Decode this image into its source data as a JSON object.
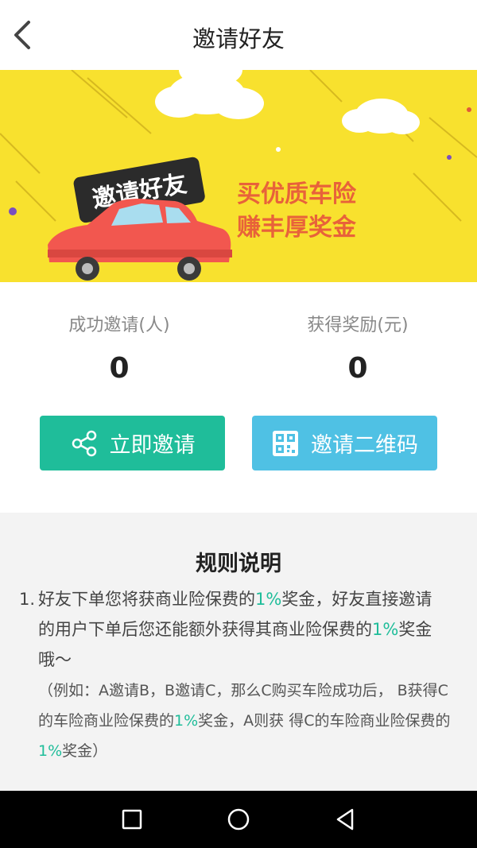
{
  "nav": {
    "title": "邀请好友"
  },
  "banner": {
    "badge": "邀请好友",
    "slogan_line1": "买优质车险",
    "slogan_line2": "赚丰厚奖金",
    "colors": {
      "background": "#f8e12e",
      "car": "#f2574f",
      "slogan": "#e8623a"
    }
  },
  "stats": {
    "invited_label": "成功邀请(人)",
    "invited_value": "0",
    "reward_label": "获得奖励(元)",
    "reward_value": "0"
  },
  "buttons": {
    "invite_label": "立即邀请",
    "qr_label": "邀请二维码"
  },
  "rules": {
    "title": "规则说明",
    "item1_num": "1.",
    "item1_part1": "好友下单您将获商业险保费的",
    "item1_pct1": "1%",
    "item1_part2": "奖金，好友直接邀请的用户下单后您还能额外获得其商业险保费的",
    "item1_pct2": "1%",
    "item1_part3": "奖金哦～",
    "example_part1": "（例如：A邀请B，B邀请C，那么C购买车险成功后， B获得C的车险商业险保费的",
    "example_pct1": "1%",
    "example_part2": "奖金，A则获 得C的车险商业险保费的",
    "example_pct2": "1%",
    "example_part3": "奖金）"
  },
  "colors": {
    "accent_green": "#1fbd9a",
    "accent_blue": "#4fc1e4"
  }
}
